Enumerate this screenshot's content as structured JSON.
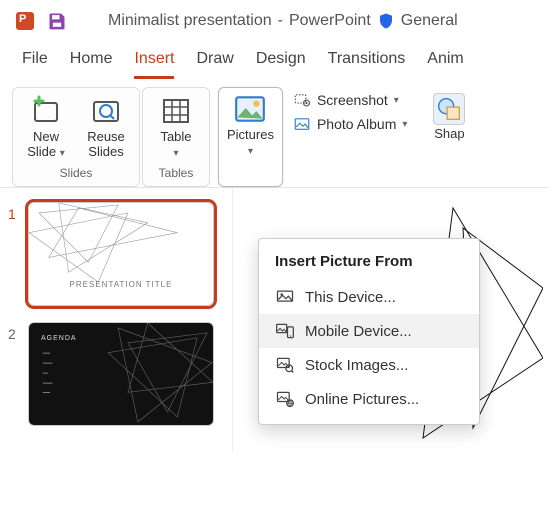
{
  "titlebar": {
    "doc_name": "Minimalist presentation",
    "sep": "-",
    "app_name": "PowerPoint",
    "sensitivity": "General"
  },
  "tabs": {
    "file": "File",
    "home": "Home",
    "insert": "Insert",
    "draw": "Draw",
    "design": "Design",
    "transitions": "Transitions",
    "animations": "Anim"
  },
  "ribbon": {
    "new_slide": "New\nSlide",
    "reuse_slides": "Reuse\nSlides",
    "group_slides": "Slides",
    "table": "Table",
    "group_tables": "Tables",
    "pictures": "Pictures",
    "screenshot": "Screenshot",
    "photo_album": "Photo Album",
    "shapes": "Shap"
  },
  "dropdown": {
    "header": "Insert Picture From",
    "this_device": "This Device...",
    "mobile_device": "Mobile Device...",
    "stock_images": "Stock Images...",
    "online_pictures": "Online Pictures..."
  },
  "thumbs": {
    "n1": "1",
    "n2": "2",
    "slide1_title": "PRESENTATION TITLE",
    "slide2_title": "AGENDA"
  }
}
